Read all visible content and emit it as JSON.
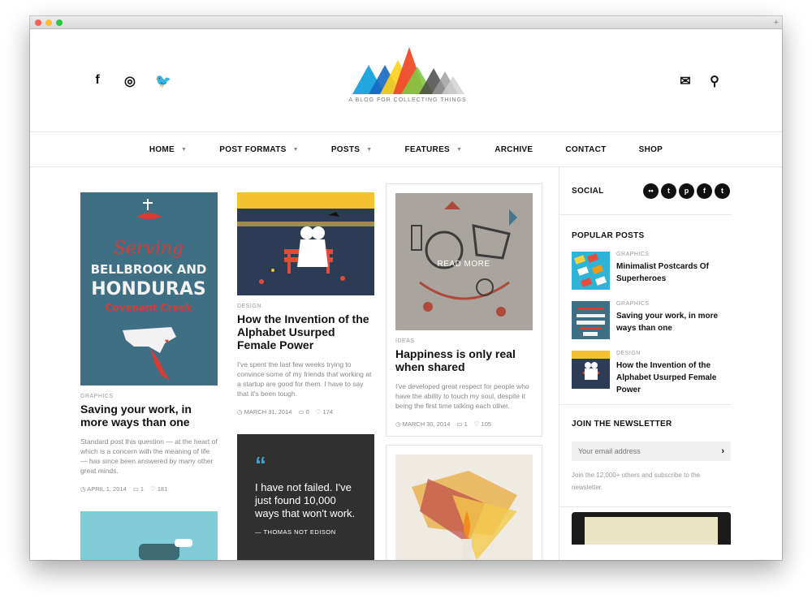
{
  "header": {
    "tagline": "A BLOG FOR COLLECTING THINGS",
    "social_left": [
      {
        "icon": "facebook-icon",
        "glyph": "f"
      },
      {
        "icon": "dribbble-icon",
        "glyph": "◎"
      },
      {
        "icon": "twitter-icon",
        "glyph": "🐦"
      }
    ],
    "mail_glyph": "✉",
    "search_glyph": "⚲"
  },
  "nav": [
    {
      "label": "HOME",
      "caret": "▼"
    },
    {
      "label": "POST FORMATS",
      "caret": "▼"
    },
    {
      "label": "POSTS",
      "caret": "▼"
    },
    {
      "label": "FEATURES",
      "caret": "▼"
    },
    {
      "label": "ARCHIVE",
      "caret": ""
    },
    {
      "label": "CONTACT",
      "caret": ""
    },
    {
      "label": "SHOP",
      "caret": ""
    }
  ],
  "posts": {
    "p1": {
      "category": "GRAPHICS",
      "title": "Saving your work, in more ways than one",
      "excerpt": "Standard post this question — at the heart of which is a concern with the meaning of life — has since been answered by many other great minds.",
      "date": "◷ APRIL 1, 2014",
      "comments": "▭ 1",
      "likes": "♡ 181",
      "img_text": {
        "line1": "Serving",
        "line2": "BELLBROOK AND",
        "line3": "HONDURAS",
        "line4": "Covenant Creek"
      }
    },
    "p2": {
      "category": "DESIGN",
      "title": "How the Invention of the Alphabet Usurped Female Power",
      "excerpt": "I've spent the last few weeks trying to convince some of my friends that working at a startup are good for them. I have to say that it's been tough.",
      "date": "◷ MARCH 31, 2014",
      "comments": "▭ 0",
      "likes": "♡ 174"
    },
    "p3": {
      "category": "IDEAS",
      "title": "Happiness is only real when shared",
      "excerpt": "I've developed great respect for people who have the ability to touch my soul, despite it being the first time talking each other.",
      "date": "◷ MARCH 30, 2014",
      "comments": "▭ 1",
      "likes": "♡ 105",
      "read_more": "READ MORE"
    },
    "quote": {
      "mark": "“",
      "text": "I have not failed. I've just found 10,000 ways that won't work.",
      "author": "— THOMAS NOT EDISON"
    }
  },
  "sidebar": {
    "social_title": "SOCIAL",
    "social_icons": [
      {
        "icon": "flickr-icon",
        "glyph": "••"
      },
      {
        "icon": "tumblr-icon",
        "glyph": "t"
      },
      {
        "icon": "pinterest-icon",
        "glyph": "p"
      },
      {
        "icon": "facebook-icon",
        "glyph": "f"
      },
      {
        "icon": "twitter-icon",
        "glyph": "t"
      }
    ],
    "popular_title": "POPULAR POSTS",
    "popular": [
      {
        "category": "GRAPHICS",
        "title": "Minimalist Postcards Of Superheroes"
      },
      {
        "category": "GRAPHICS",
        "title": "Saving your work, in more ways than one"
      },
      {
        "category": "DESIGN",
        "title": "How the Invention of the Alphabet Usurped Female Power"
      }
    ],
    "newsletter_title": "JOIN THE NEWSLETTER",
    "newsletter_placeholder": "Your email address",
    "newsletter_arrow": "›",
    "newsletter_note": "Join the 12,000+ others and subscribe to the newsletter."
  },
  "window": {
    "plus": "+"
  },
  "colors": {
    "quote_accent": "#33a8d6",
    "dark_card": "#303030",
    "poster_blue": "#3f6f84",
    "poster_red": "#d93c33"
  }
}
